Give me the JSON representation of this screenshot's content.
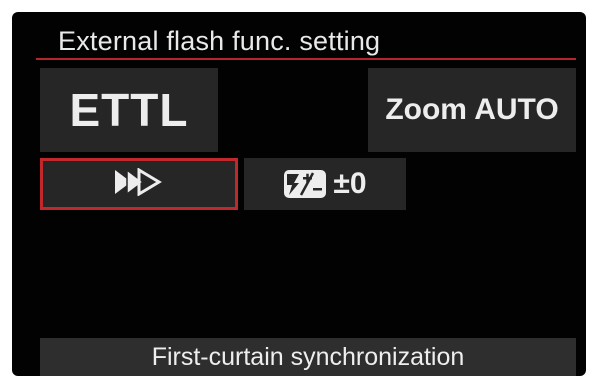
{
  "screen": {
    "title": "External flash func. setting"
  },
  "settings": {
    "flash_mode": "ETTL",
    "zoom": "Zoom AUTO",
    "sync_icon": "first-curtain-sync-icon",
    "fec_icon": "flash-exposure-compensation-icon",
    "fec_value": "±0"
  },
  "status": {
    "text": "First-curtain synchronization"
  },
  "colors": {
    "background": "#020202",
    "tile": "#262626",
    "accent_red": "#c0282c",
    "text": "#ededed",
    "status_bar": "#2e2e2e"
  }
}
